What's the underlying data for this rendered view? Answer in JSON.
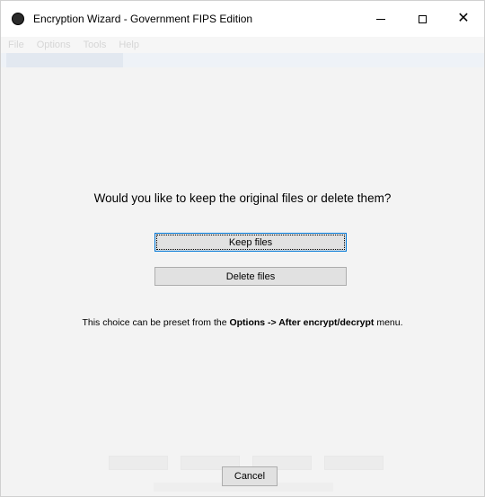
{
  "window": {
    "title": "Encryption Wizard - Government FIPS Edition",
    "controls": {
      "minimize": "minimize",
      "maximize": "maximize",
      "close": "✕"
    }
  },
  "menu": {
    "items": [
      "File",
      "Options",
      "Tools",
      "Help"
    ]
  },
  "dialog": {
    "question": "Would you like to keep the original files or delete them?",
    "keep_label": "Keep files",
    "delete_label": "Delete files",
    "hint_prefix": "This choice can be preset from the ",
    "hint_bold": "Options -> After encrypt/decrypt",
    "hint_suffix": " menu.",
    "cancel_label": "Cancel"
  },
  "colors": {
    "focus_border": "#0078d7",
    "button_face": "#e1e1e1",
    "background": "#f3f3f3"
  }
}
